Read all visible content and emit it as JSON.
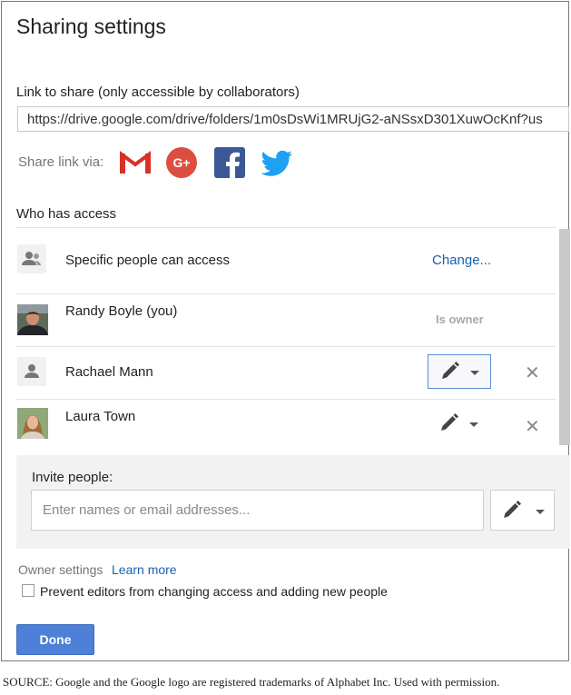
{
  "dialog": {
    "title": "Sharing settings",
    "link_label": "Link to share (only accessible by collaborators)",
    "link_value": "https://drive.google.com/drive/folders/1m0sDsWi1MRUjG2-aNSsxD301XuwOcKnf?us",
    "share_via_label": "Share link via:",
    "share_targets": [
      "gmail-icon",
      "google-plus-icon",
      "facebook-icon",
      "twitter-icon"
    ],
    "who_has_access_label": "Who has access",
    "access_rows": [
      {
        "name": "Specific people can access",
        "action": "Change...",
        "icon": "people-icon"
      },
      {
        "name": "Randy Boyle (you)",
        "role": "Is owner",
        "icon": "avatar-photo"
      },
      {
        "name": "Rachael Mann",
        "icon": "person-icon",
        "permission_icon": "pencil-icon"
      },
      {
        "name": "Laura Town",
        "icon": "avatar-photo",
        "permission_icon": "pencil-icon"
      }
    ],
    "invite": {
      "label": "Invite people:",
      "placeholder": "Enter names or email addresses...",
      "permission_icon": "pencil-icon"
    },
    "owner_settings_label": "Owner settings",
    "learn_more": "Learn more",
    "prevent_editors_label": "Prevent editors from changing access and adding new people",
    "prevent_editors_checked": false,
    "done_label": "Done"
  },
  "source_note": "SOURCE: Google and the Google logo are registered trademarks of Alphabet Inc. Used with permission.",
  "colors": {
    "link_blue": "#1a5fb4",
    "done_blue": "#4d80d6",
    "gmail_red": "#d93025",
    "google_plus_red": "#dc4e41",
    "facebook_blue": "#3b5998",
    "twitter_blue": "#1da1f2"
  }
}
